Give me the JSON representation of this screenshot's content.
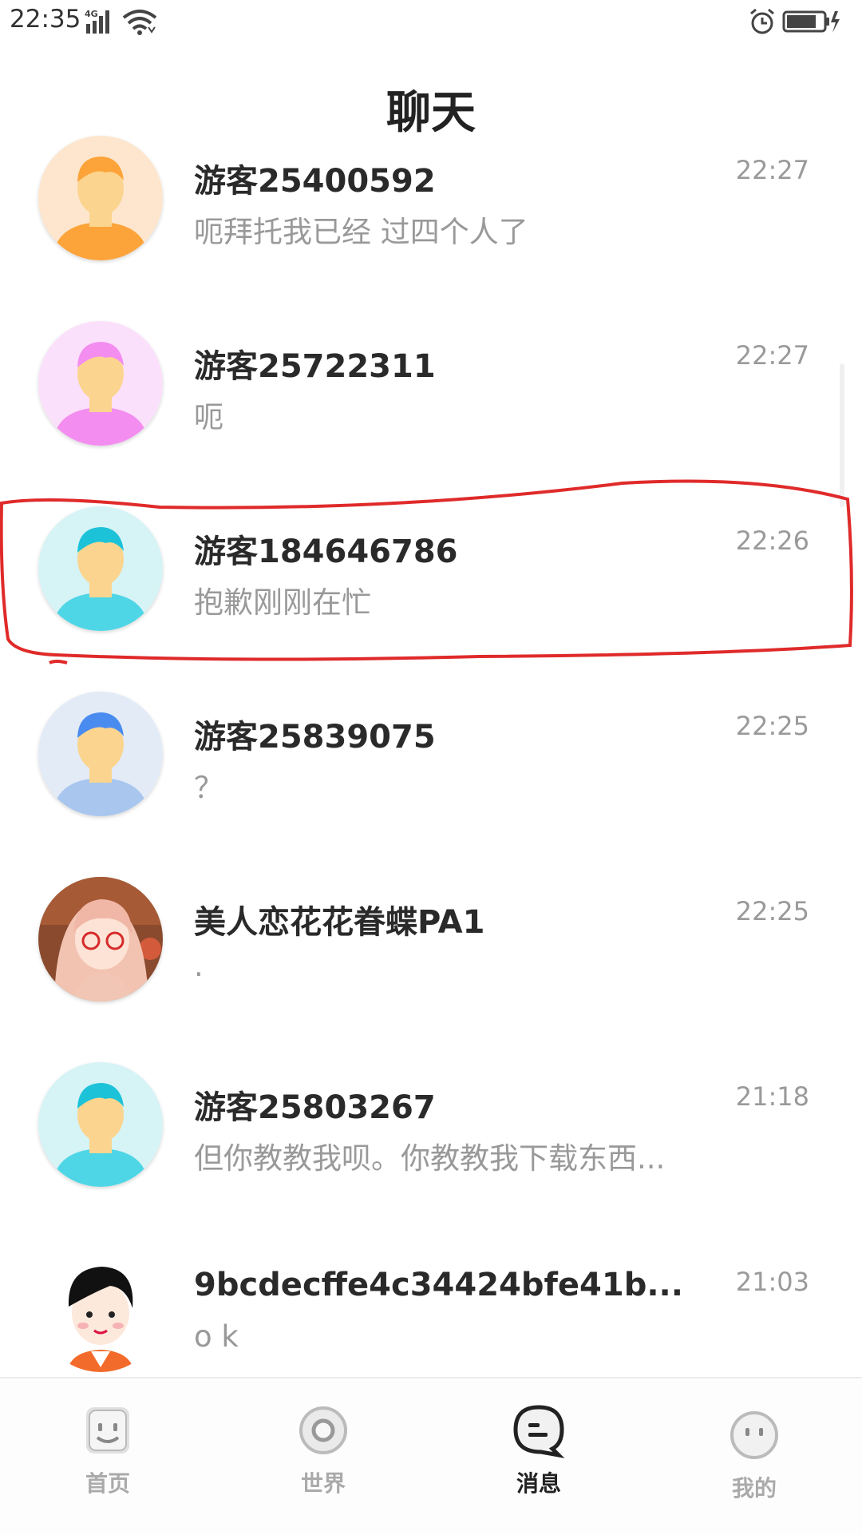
{
  "status_bar": {
    "time": "22:35",
    "network_label": "4G",
    "icons": [
      "signal-icon",
      "wifi-icon",
      "alarm-icon",
      "battery-charging-icon"
    ]
  },
  "header": {
    "title": "聊天"
  },
  "chats": [
    {
      "name": "游客25400592",
      "message": "呃拜托我已经 过四个人了",
      "time": "22:27",
      "avatar": "orange-guest-avatar"
    },
    {
      "name": "游客25722311",
      "message": "呃",
      "time": "22:27",
      "avatar": "pink-guest-avatar"
    },
    {
      "name": "游客184646786",
      "message": "抱歉刚刚在忙",
      "time": "22:26",
      "avatar": "cyan-guest-avatar"
    },
    {
      "name": "游客25839075",
      "message": "？",
      "time": "22:25",
      "avatar": "blue-guest-avatar"
    },
    {
      "name": "美人恋花花眷蝶PA1",
      "message": ".",
      "time": "22:25",
      "avatar": "anime-girl-avatar"
    },
    {
      "name": "游客25803267",
      "message": "但你教教我呗。你教教我下载东西...",
      "time": "21:18",
      "avatar": "cyan-guest-avatar"
    },
    {
      "name": "9bcdecffe4c34424bfe41b...",
      "message": "o  k",
      "time": "21:03",
      "avatar": "cartoon-boy-avatar"
    }
  ],
  "colors": {
    "orange_avatar": "#fca33a",
    "pink_avatar": "#f48df0",
    "cyan_avatar": "#4fd6e6",
    "blue_avatar": "#4a8bf0",
    "highlight_stroke": "#e02a2a",
    "active_tab": "#222222",
    "inactive_tab": "#aaaaaa"
  },
  "bottom_nav": {
    "tabs": [
      {
        "label": "首页",
        "icon": "home-face-icon",
        "active": false
      },
      {
        "label": "世界",
        "icon": "world-ring-icon",
        "active": false
      },
      {
        "label": "消息",
        "icon": "message-bubble-icon",
        "active": true
      },
      {
        "label": "我的",
        "icon": "profile-face-icon",
        "active": false
      }
    ]
  }
}
